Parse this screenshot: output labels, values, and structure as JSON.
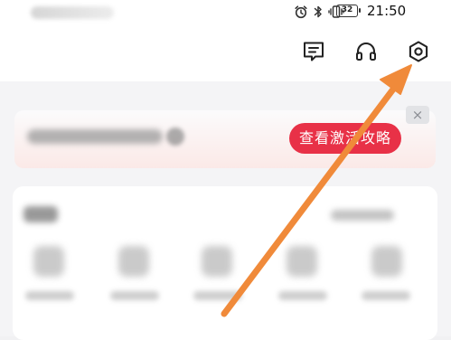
{
  "status_bar": {
    "time": "21:50",
    "battery": "32",
    "icons": [
      "alarm-icon",
      "bluetooth-icon",
      "vibrate-icon",
      "battery-icon"
    ]
  },
  "header": {
    "icons": [
      "feedback-icon",
      "headset-icon",
      "settings-icon"
    ]
  },
  "banner": {
    "button_label": "查看激活攻略",
    "close_label": "×"
  },
  "annotation": {
    "arrow_color": "#f08a3a",
    "target": "settings-icon"
  },
  "colors": {
    "accent_red": "#e83147",
    "icon_dark": "#222222"
  }
}
